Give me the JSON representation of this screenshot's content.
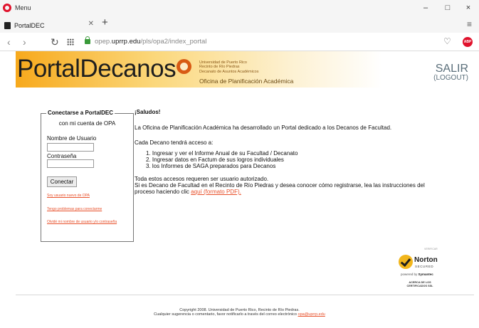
{
  "browser": {
    "menu_label": "Menu",
    "tab_title": "PortalDEC",
    "url_host": "opep.",
    "url_domain": "uprrp.edu",
    "url_path": "/pls/opa2/index_portal",
    "window_controls": [
      "–",
      "□",
      "×"
    ]
  },
  "banner": {
    "logo": "PortalDecanos",
    "university_lines": [
      "Universidad de Puerto Rico",
      "Recinto de Río Piedras",
      "Decanato de Asuntos Académicos"
    ],
    "office": "Oficina de Planificación Académica",
    "logout_main": "SALIR",
    "logout_sub": "(LOGOUT)"
  },
  "login": {
    "legend": "Conectarse a PortalDEC",
    "subtitle": "con mi cuenta de OPA",
    "username_label": "Nombre de Usuario",
    "username_value": "",
    "password_label": "Contraseña",
    "password_value": "",
    "submit_label": "Conectar",
    "link_new_user": "Soy usuario nuevo de OPA",
    "link_problems": "Tengo problemas para conectarme",
    "link_forgot": "Olvidé mi nombre de usuario y/o contraseña"
  },
  "main": {
    "greeting": "¡Saludos!",
    "intro": "La Oficina de Planificación Académica ha desarrollado un Portal dedicado a los Decanos de Facultad.",
    "access_intro": "Cada Decano tendrá acceso a:",
    "access_items": [
      "1. Ingresar y ver el Informe Anual de su Facultad / Decanato",
      "2. Ingresar datos en Factum de sus logros individuales",
      "3. los Informes de SAGA preparados para Decanos"
    ],
    "auth_note": "Toda estos accesos requeren ser usuario autorizado.",
    "register_text": "Si es Decano de Facultad en el Recinto de Río Piedras y desea conocer cómo registrarse, lea las instrucciones del",
    "register_text_2": "proceso haciendo clic",
    "register_link": "aquí (formato PDF)."
  },
  "norton": {
    "small_label": "VERIFICAR",
    "brand": "Norton",
    "secured": "SECURED",
    "powered_prefix": "powered by",
    "powered_brand": "Symantec",
    "about_line1": "ACERCA DE LOS",
    "about_line2": "CERTIFICADOS SSL"
  },
  "footer": {
    "copyright": "Copyright 2008. Universidad de Puerto Rico, Recinto de Río Piedras.",
    "contact_text": "Cualquier sugerencia o comentario, favor notificarlo a través del correo electrónico",
    "contact_email": "opa@uprrp.edu"
  }
}
